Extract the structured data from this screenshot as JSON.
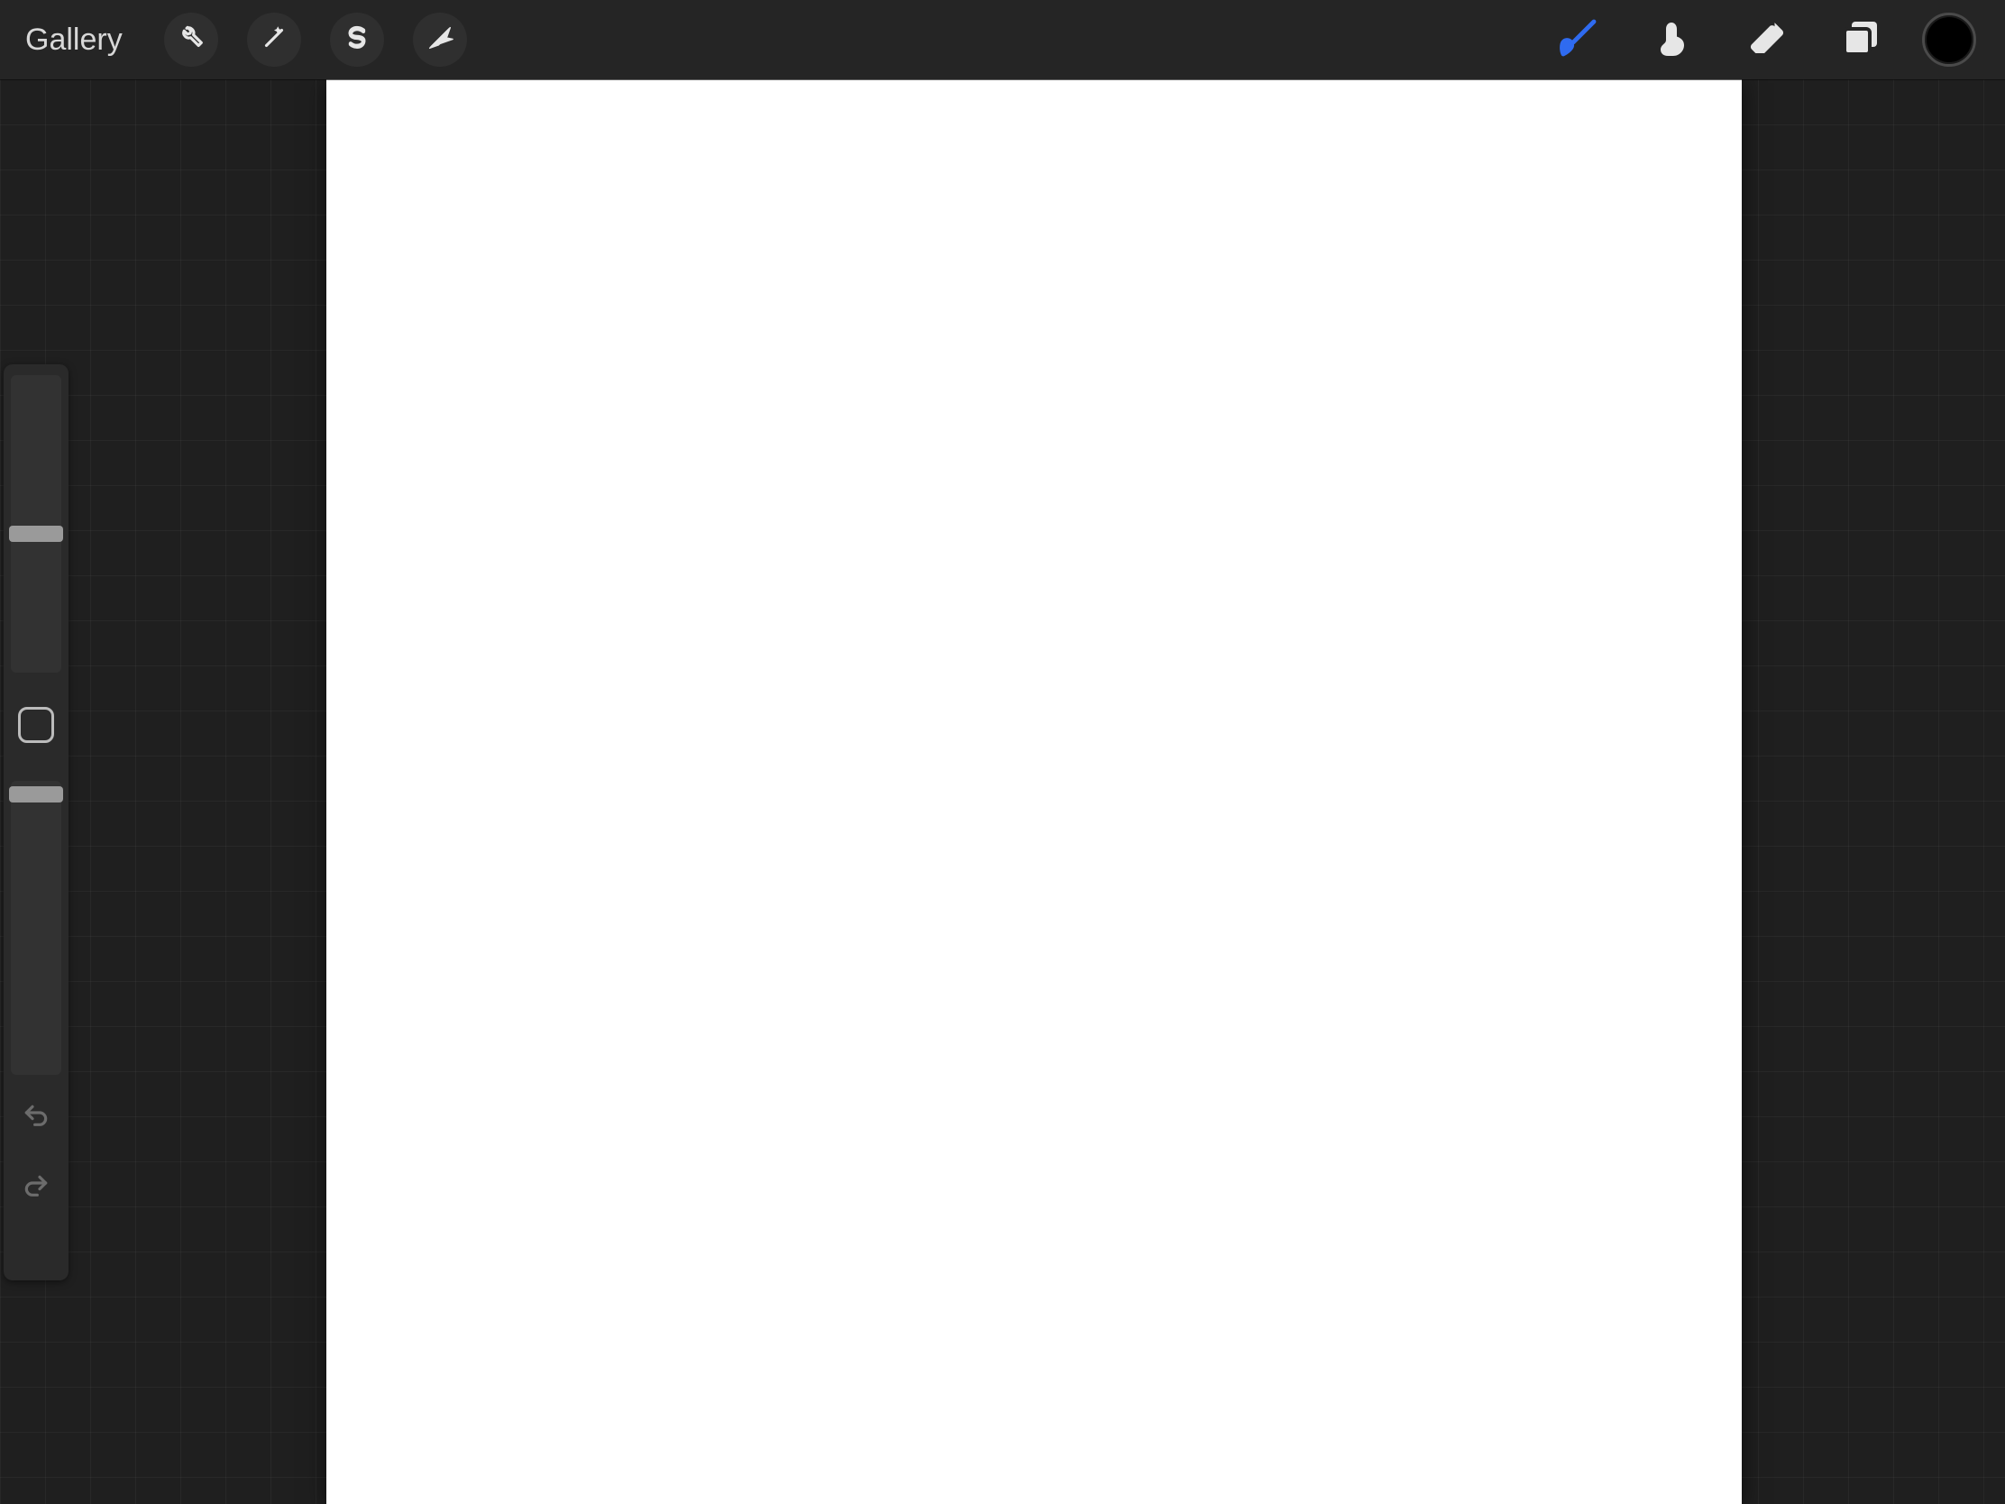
{
  "toolbar": {
    "gallery_label": "Gallery",
    "actions_icon": "wrench-icon",
    "adjustments_icon": "wand-icon",
    "selection_icon": "s-ribbon-icon",
    "transform_icon": "arrow-cursor-icon",
    "brush_icon": "paint-brush-icon",
    "smudge_icon": "finger-smudge-icon",
    "eraser_icon": "eraser-icon",
    "layers_icon": "layers-icon",
    "current_color": "#000000"
  },
  "sidebar": {
    "brush_size_percent": 52,
    "brush_opacity_percent": 98,
    "modify_icon": "square-outline-icon",
    "undo_icon": "undo-icon",
    "redo_icon": "redo-icon"
  },
  "colors": {
    "active_tool": "#2f6bf0",
    "inactive_tool": "#e6e6e6",
    "panel_bg": "#252525"
  }
}
